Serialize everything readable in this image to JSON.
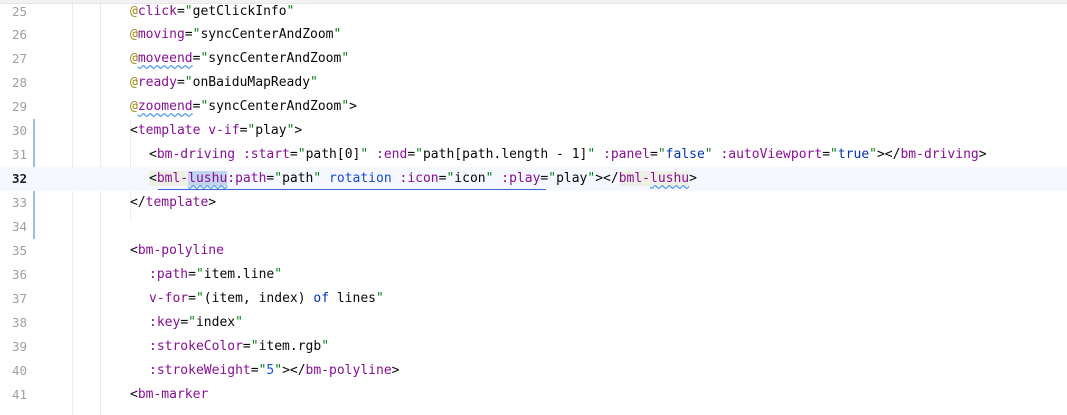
{
  "editor": {
    "first_line_number": 25,
    "current_line": 32,
    "lines": [
      {
        "n": "25",
        "code": "@click=\"getClickInfo\""
      },
      {
        "n": "26",
        "code": "@moving=\"syncCenterAndZoom\""
      },
      {
        "n": "27",
        "code": "@moveend=\"syncCenterAndZoom\""
      },
      {
        "n": "28",
        "code": "@ready=\"onBaiduMapReady\""
      },
      {
        "n": "29",
        "code": "@zoomend=\"syncCenterAndZoom\">"
      },
      {
        "n": "30",
        "code": "<template v-if=\"play\">"
      },
      {
        "n": "31",
        "code": "<bm-driving :start=\"path[0]\" :end=\"path[path.length - 1]\" :panel=\"false\" :autoViewport=\"true\"></bm-driving>"
      },
      {
        "n": "32",
        "code": "<bml-lushu :path=\"path\" rotation :icon=\"icon\" :play=\"play\"></bml-lushu>"
      },
      {
        "n": "33",
        "code": "</template>"
      },
      {
        "n": "34",
        "code": ""
      },
      {
        "n": "35",
        "code": "<bm-polyline"
      },
      {
        "n": "36",
        "code": ":path=\"item.line\""
      },
      {
        "n": "37",
        "code": "v-for=\"(item, index) of lines\""
      },
      {
        "n": "38",
        "code": ":key=\"index\""
      },
      {
        "n": "39",
        "code": ":strokeColor=\"item.rgb\""
      },
      {
        "n": "40",
        "code": ":strokeWeight=\"5\"></bm-polyline>"
      },
      {
        "n": "41",
        "code": "<bm-marker"
      }
    ]
  },
  "colors": {
    "tag": "#0033b3",
    "tag_name": "#871094",
    "attribute": "#174ad4",
    "string": "#067d17",
    "keyword": "#0033b3",
    "number": "#1750eb",
    "line_number": "#a0a0a0",
    "current_line_bg": "#f5f8fe",
    "change_marker": "#9bbce7"
  },
  "icons": {
    "gutter_hint": "lightbulb-icon"
  }
}
